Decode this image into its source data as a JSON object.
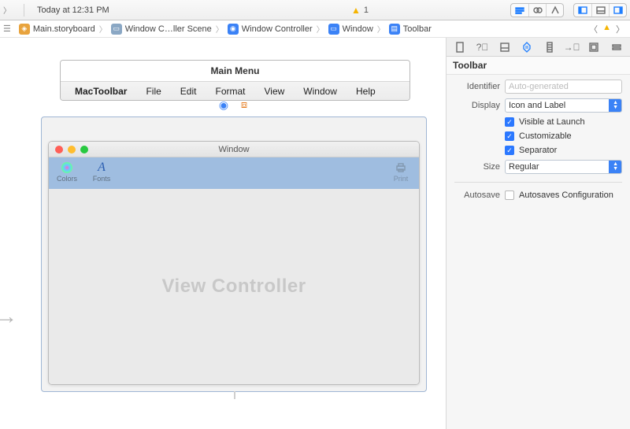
{
  "topbar": {
    "time": "Today at 12:31 PM",
    "warning_count": "1"
  },
  "breadcrumbs": {
    "items": [
      {
        "label": "Main.storyboard",
        "color": "#e8a33d"
      },
      {
        "label": "Window C…ller Scene",
        "color": "#8aa7c4"
      },
      {
        "label": "Window Controller",
        "color": "#3b82f6"
      },
      {
        "label": "Window",
        "color": "#3b82f6"
      },
      {
        "label": "Toolbar",
        "color": "#3b82f6"
      }
    ]
  },
  "menu": {
    "title": "Main Menu",
    "items": [
      "MacToolbar",
      "File",
      "Edit",
      "Format",
      "View",
      "Window",
      "Help"
    ]
  },
  "window": {
    "title": "Window",
    "toolbar": {
      "colors": "Colors",
      "fonts": "Fonts",
      "print": "Print"
    },
    "body_label": "View Controller"
  },
  "inspector": {
    "header": "Toolbar",
    "fields": {
      "identifier_label": "Identifier",
      "identifier_placeholder": "Auto-generated",
      "display_label": "Display",
      "display_value": "Icon and Label",
      "visible_label": "Visible at Launch",
      "customizable_label": "Customizable",
      "separator_label": "Separator",
      "size_label": "Size",
      "size_value": "Regular",
      "autosave_label": "Autosave",
      "autosave_opt": "Autosaves Configuration"
    }
  }
}
